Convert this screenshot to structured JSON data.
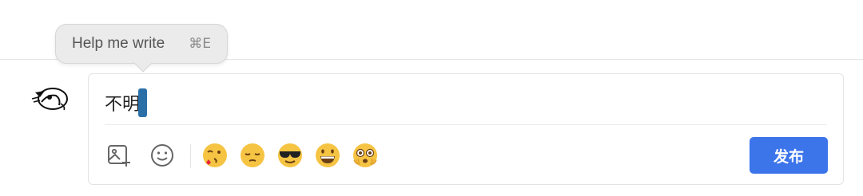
{
  "tooltip": {
    "label": "Help me write",
    "shortcut": "⌘E"
  },
  "composer": {
    "text": "不明",
    "publish_label": "发布",
    "toolbar": {
      "icons": [
        "image-add-icon",
        "emoji-picker-icon"
      ],
      "emojis": [
        "wink-kiss-emoji-icon",
        "pensive-emoji-icon",
        "sunglasses-emoji-icon",
        "grin-emoji-icon",
        "flushed-emoji-icon"
      ]
    }
  },
  "colors": {
    "accent": "#3c74ea",
    "caret": "#2a6fa8"
  }
}
